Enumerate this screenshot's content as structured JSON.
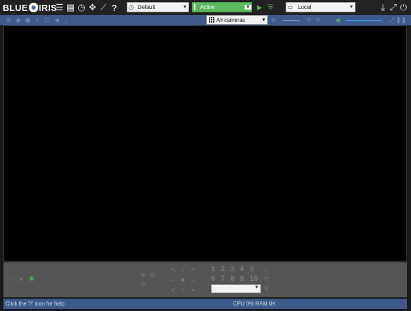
{
  "app": {
    "logo_left": "BLUE",
    "logo_right": "IRIS"
  },
  "toolbar": {
    "profile_value": "Default",
    "schedule_value": "Active",
    "server_value": "Local",
    "help_label": "?"
  },
  "camera_bar": {
    "group_value": "All cameras"
  },
  "ptz": {
    "presets": [
      "1",
      "2",
      "3",
      "4",
      "5",
      "6",
      "7",
      "8",
      "9",
      "10"
    ],
    "preset_select_value": ""
  },
  "status": {
    "left_text": "Click the '?' icon for help",
    "right_text": "CPU 0% RAM 0K"
  },
  "colors": {
    "status_active": "#5cb85c",
    "bar_blue": "#3c5a8c",
    "volume_blue": "#3b8ed9"
  },
  "icons": [
    "list-icon",
    "clip-icon",
    "timeline-icon",
    "ptz-icon",
    "stats-icon",
    "help-icon",
    "play-icon",
    "shield-icon",
    "monitor-icon",
    "download-icon",
    "fullscreen-icon",
    "power-icon"
  ]
}
